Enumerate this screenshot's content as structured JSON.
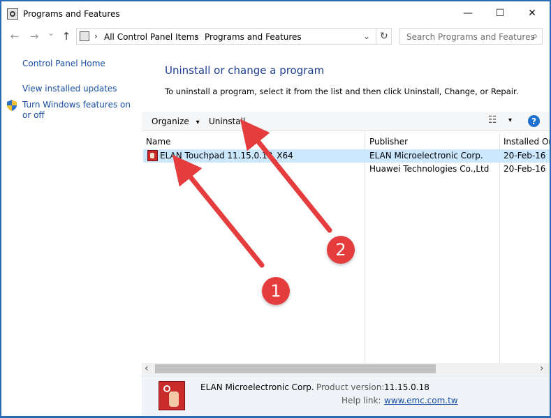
{
  "window": {
    "title": "Programs and Features",
    "minimize_glyph": "—",
    "maximize_glyph": "☐",
    "close_glyph": "✕"
  },
  "nav": {
    "back_glyph": "←",
    "forward_glyph": "→",
    "recent_glyph": "⌄",
    "up_glyph": "↑",
    "breadcrumb": [
      "All Control Panel Items",
      "Programs and Features"
    ],
    "breadcrumb_separator": "›",
    "refresh_glyph": "↻",
    "search_placeholder": "Search Programs and Features",
    "search_glyph": "⌕"
  },
  "sidebar": {
    "home_link": "Control Panel Home",
    "installed_updates_link": "View installed updates",
    "windows_features_link": "Turn Windows features on or off"
  },
  "main": {
    "heading": "Uninstall or change a program",
    "description": "To uninstall a program, select it from the list and then click Uninstall, Change, or Repair."
  },
  "toolbar": {
    "organize_label": "Organize",
    "dropdown_glyph": "▾",
    "uninstall_label": "Uninstall",
    "view_glyph": "☷",
    "help_glyph": "?"
  },
  "table": {
    "columns": [
      "Name",
      "Publisher",
      "Installed On"
    ],
    "sort_glyph": "⌃",
    "rows": [
      {
        "name": "ELAN Touchpad 11.15.0.18_X64",
        "publisher": "ELAN Microelectronic Corp.",
        "installed_on": "20-Feb-16",
        "selected": true
      },
      {
        "name": "",
        "publisher": "Huawei Technologies Co.,Ltd",
        "installed_on": "20-Feb-16",
        "selected": false
      }
    ]
  },
  "scrollbar": {
    "left_glyph": "‹",
    "right_glyph": "›"
  },
  "details": {
    "publisher": "ELAN Microelectronic Corp.",
    "product_version_label": "Product version:",
    "product_version": "11.15.0.18",
    "help_link_label": "Help link:",
    "help_link": "www.emc.com.tw"
  },
  "annotations": {
    "badge_1": "1",
    "badge_2": "2",
    "color": "#e53d3d"
  }
}
